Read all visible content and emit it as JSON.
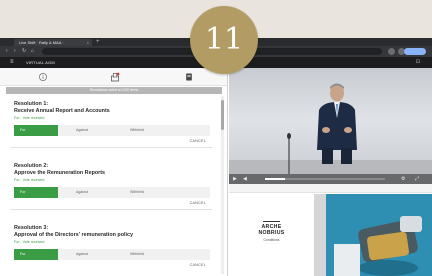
{
  "badge": {
    "number": "11"
  },
  "browser": {
    "tab_title": "Live Shift · Rally & M&A ·",
    "tab_close": "×",
    "new_tab": "+",
    "back": "‹",
    "forward": "›",
    "reload": "↻",
    "home": "⌂",
    "url": ""
  },
  "app": {
    "title": "VIRTUAL AGM",
    "menu": "≡",
    "right_label": "",
    "exit": "⊡"
  },
  "left": {
    "icons": [
      "info-icon",
      "vote-icon",
      "document-icon"
    ],
    "notice": "Resolutions voted on 2/20 items",
    "resolutions": [
      {
        "title_line1": "Resolution 1:",
        "title_line2": "Receive Annual Report and Accounts",
        "vote_status": "For - Vote received",
        "options": [
          "For",
          "Against",
          "Withheld"
        ],
        "cancel": "CANCEL"
      },
      {
        "title_line1": "Resolution 2:",
        "title_line2": "Approve the Remuneration Reports",
        "vote_status": "For - Vote received",
        "options": [
          "For",
          "Against",
          "Withheld"
        ],
        "cancel": "CANCEL"
      },
      {
        "title_line1": "Resolution 3:",
        "title_line2": "Approval of the Directors' remuneration policy",
        "vote_status": "For - Vote received",
        "options": [
          "For",
          "Against",
          "Withheld"
        ],
        "cancel": "CANCEL"
      }
    ]
  },
  "right": {
    "player": {
      "play": "▶",
      "volume": "◀",
      "settings": "⚙",
      "fullscreen": "⤢"
    },
    "caption": "",
    "slide": {
      "brand_line1": "ARCHE",
      "brand_line2": "NOBRIUS",
      "brand_sub": "Conditions"
    }
  },
  "colors": {
    "vote_green": "#3a9c44",
    "badge_gold": "#b39c63",
    "notice_grey": "#b6b6b6",
    "slide_teal": "#2e8fb2"
  }
}
